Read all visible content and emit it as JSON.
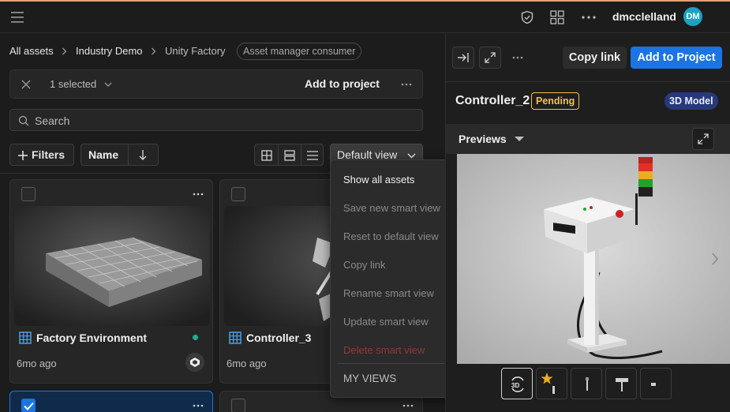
{
  "topbar": {
    "username": "dmcclelland",
    "avatar_initials": "DM",
    "avatar_color": "#1aa3c2"
  },
  "breadcrumb": {
    "items": [
      "All assets",
      "Industry Demo",
      "Unity Factory"
    ],
    "tag": "Asset manager consumer"
  },
  "selection_bar": {
    "count_label": "1 selected",
    "add_label": "Add to project"
  },
  "search": {
    "placeholder": "Search"
  },
  "toolbar": {
    "filters_label": "Filters",
    "sort_label": "Name",
    "view_label": "Default view"
  },
  "assets": [
    {
      "name": "Factory Environment",
      "age": "6mo ago",
      "status_color": "#1fb08a",
      "checked": false
    },
    {
      "name": "Controller_3",
      "age": "6mo ago",
      "checked": false
    },
    {
      "checked": true
    },
    {
      "checked": false
    }
  ],
  "view_menu": {
    "items": [
      {
        "label": "Show all assets",
        "state": "enabled"
      },
      {
        "label": "Save new smart view",
        "state": "disabled"
      },
      {
        "label": "Reset to default view",
        "state": "disabled"
      },
      {
        "label": "Copy link",
        "state": "disabled"
      },
      {
        "label": "Rename smart view",
        "state": "disabled"
      },
      {
        "label": "Update smart view",
        "state": "disabled"
      },
      {
        "label": "Delete smart view",
        "state": "danger-disabled"
      }
    ],
    "section_label": "MY VIEWS"
  },
  "detail": {
    "copy_link_label": "Copy link",
    "add_to_project_label": "Add to Project",
    "title": "Controller_2",
    "status_badge": "Pending",
    "type_badge": "3D Model",
    "previews_label": "Previews",
    "accent_color": "#1b74e4",
    "pending_color": "#f2c14e"
  }
}
